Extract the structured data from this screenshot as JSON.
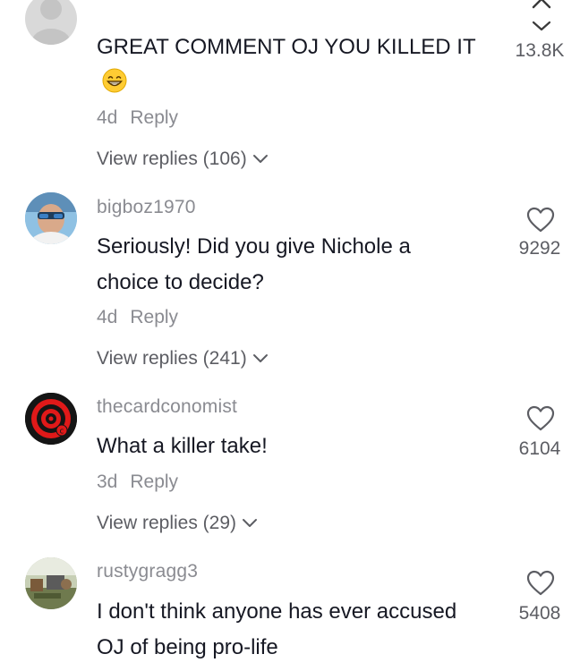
{
  "top": {
    "close_glyph": "×"
  },
  "comments": [
    {
      "username": "",
      "text": "GREAT COMMENT OJ YOU KILLED IT",
      "emoji": "😁",
      "age": "4d",
      "reply_label": "Reply",
      "view_replies": "View replies (106)",
      "likes": "13.8K"
    },
    {
      "username": "bigboz1970",
      "text": "Seriously! Did you give Nichole a choice to decide?",
      "age": "4d",
      "reply_label": "Reply",
      "view_replies": "View replies (241)",
      "likes": "9292"
    },
    {
      "username": "thecardconomist",
      "text": "What a killer take!",
      "age": "3d",
      "reply_label": "Reply",
      "view_replies": "View replies (29)",
      "likes": "6104"
    },
    {
      "username": "rustygragg3",
      "text": "I don't think anyone has ever accused OJ of being pro-life",
      "likes": "5408"
    }
  ],
  "colors": {
    "primary_text": "#161823",
    "secondary_text": "#8a8b91",
    "replies_text": "#5c5d63"
  }
}
